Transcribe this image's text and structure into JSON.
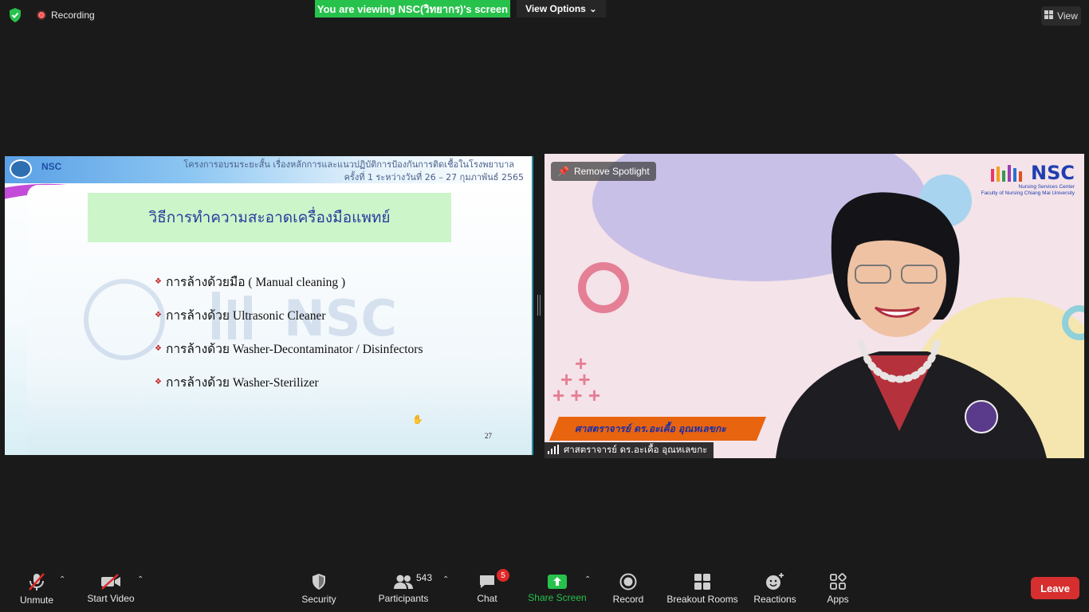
{
  "top": {
    "recording_label": "Recording",
    "viewing_banner": "You are viewing NSC(วิทยากร)'s screen",
    "view_options_label": "View Options",
    "view_label": "View"
  },
  "slide": {
    "header_line1": "โครงการอบรมระยะสั้น เรื่องหลักการและแนวปฏิบัติการป้องกันการติดเชื้อในโรงพยาบาล",
    "header_line2": "ครั้งที่ 1 ระหว่างวันที่ 26 – 27 กุมภาพันธ์ 2565",
    "logo_text": "NSC",
    "heading": "วิธีการทำความสะอาดเครื่องมือแพทย์",
    "bullets": [
      "การล้างด้วยมือ ( Manual cleaning )",
      "การล้างด้วย Ultrasonic Cleaner",
      "การล้างด้วย Washer-Decontaminator / Disinfectors",
      "การล้างด้วย Washer-Sterilizer"
    ],
    "page_number": "27"
  },
  "video": {
    "remove_spotlight_label": "Remove Spotlight",
    "logo_text": "NSC",
    "logo_subtitle1": "Nursing Services Center",
    "logo_subtitle2": "Faculty of Nursing Chiang Mai University",
    "banner_name": "ศาสตราจารย์ ดร.อะเคื้อ อุณหเลขกะ",
    "participant_name": "ศาสตราจารย์ ดร.อะเคื้อ อุณหเลขกะ"
  },
  "toolbar": {
    "unmute_label": "Unmute",
    "start_video_label": "Start Video",
    "security_label": "Security",
    "participants_label": "Participants",
    "participants_count": "543",
    "chat_label": "Chat",
    "chat_badge": "5",
    "share_screen_label": "Share Screen",
    "record_label": "Record",
    "breakout_label": "Breakout Rooms",
    "reactions_label": "Reactions",
    "apps_label": "Apps",
    "leave_label": "Leave"
  },
  "colors": {
    "viewing_banner": "#27c24c",
    "leave_button": "#d72f2f",
    "chat_badge": "#e02828",
    "name_banner": "#e8640f"
  }
}
